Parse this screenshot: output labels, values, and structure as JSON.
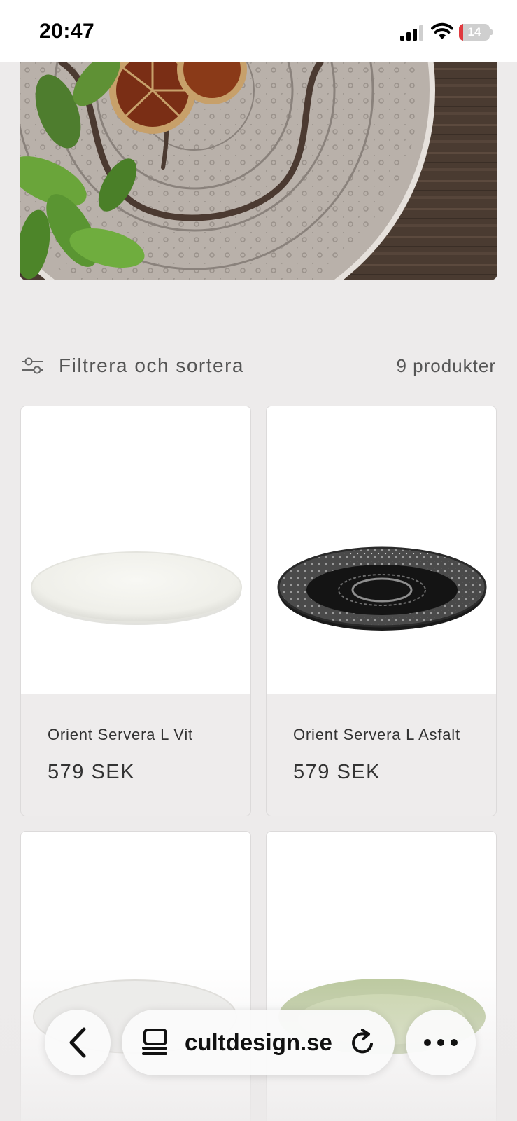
{
  "status_bar": {
    "time": "20:47",
    "battery": "14",
    "battery_level": 0.14
  },
  "hero": {
    "icon": "hero-banner-image"
  },
  "collection": {
    "filter_label": "Filtrera och sortera",
    "filter_icon": "sliders-icon",
    "product_count": "9 produkter"
  },
  "products": [
    {
      "name": "Orient Servera L Vit",
      "price": "579 SEK"
    },
    {
      "name": "Orient Servera L Asfalt",
      "price": "579 SEK"
    },
    {
      "name": "",
      "price": ""
    },
    {
      "name": "",
      "price": ""
    }
  ],
  "browser": {
    "url": "cultdesign.se",
    "back_icon": "chevron-left-icon",
    "tabs_icon": "tabs-icon",
    "reload_icon": "reload-icon",
    "more_icon": "more-icon"
  },
  "colors": {
    "background": "#edebeb",
    "battery_low": "#e0393e"
  }
}
